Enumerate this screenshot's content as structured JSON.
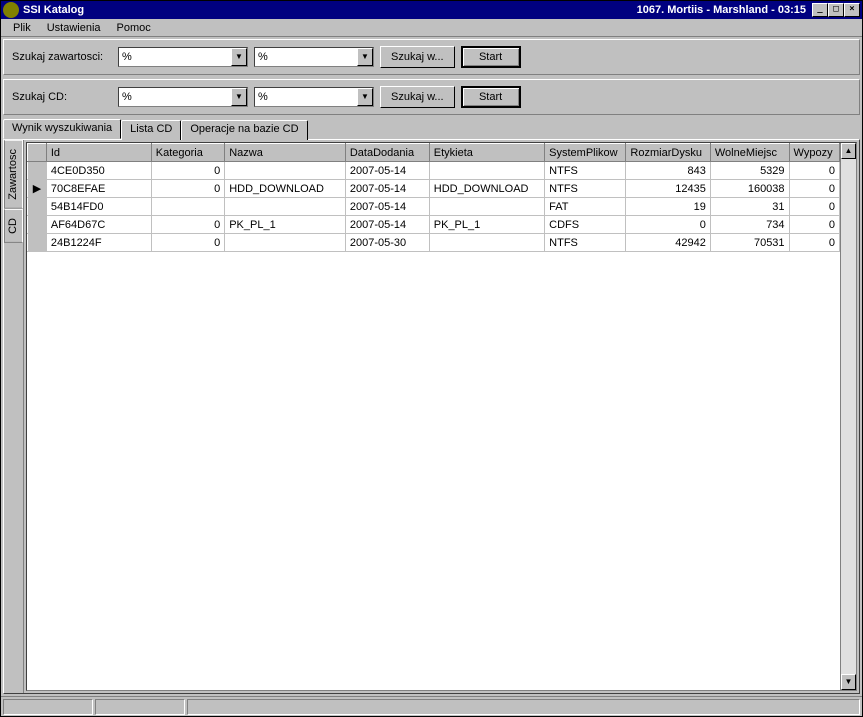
{
  "titlebar": {
    "title": "SSI Katalog",
    "right": "1067. Mortiis - Marshland - 03:15"
  },
  "menu": {
    "file": "Plik",
    "settings": "Ustawienia",
    "help": "Pomoc"
  },
  "search1": {
    "label": "Szukaj zawartosci:",
    "field1": "%",
    "field2": "%",
    "search_btn": "Szukaj w...",
    "start_btn": "Start"
  },
  "search2": {
    "label": "Szukaj CD:",
    "field1": "%",
    "field2": "%",
    "search_btn": "Szukaj w...",
    "start_btn": "Start"
  },
  "tabs": {
    "t0": "Wynik wyszukiwania",
    "t1": "Lista CD",
    "t2": "Operacje na bazie CD"
  },
  "side_tabs": {
    "t0": "Zawartosc",
    "t1": "CD"
  },
  "columns": {
    "c0": "Id",
    "c1": "Kategoria",
    "c2": "Nazwa",
    "c3": "DataDodania",
    "c4": "Etykieta",
    "c5": "SystemPlikow",
    "c6": "RozmiarDysku",
    "c7": "WolneMiejsc",
    "c8": "Wypozy"
  },
  "rows": [
    {
      "id": "4CE0D350",
      "kat": "0",
      "nazwa": "",
      "data": "2007-05-14",
      "ety": "",
      "fs": "NTFS",
      "rozm": "843",
      "wolne": "5329",
      "wyp": "0",
      "sel": ""
    },
    {
      "id": "70C8EFAE",
      "kat": "0",
      "nazwa": "HDD_DOWNLOAD",
      "data": "2007-05-14",
      "ety": "HDD_DOWNLOAD",
      "fs": "NTFS",
      "rozm": "12435",
      "wolne": "160038",
      "wyp": "0",
      "sel": "▶"
    },
    {
      "id": "54B14FD0",
      "kat": "",
      "nazwa": "",
      "data": "2007-05-14",
      "ety": "",
      "fs": "FAT",
      "rozm": "19",
      "wolne": "31",
      "wyp": "0",
      "sel": ""
    },
    {
      "id": "AF64D67C",
      "kat": "0",
      "nazwa": "PK_PL_1",
      "data": "2007-05-14",
      "ety": "PK_PL_1",
      "fs": "CDFS",
      "rozm": "0",
      "wolne": "734",
      "wyp": "0",
      "sel": ""
    },
    {
      "id": "24B1224F",
      "kat": "0",
      "nazwa": "",
      "data": "2007-05-30",
      "ety": "",
      "fs": "NTFS",
      "rozm": "42942",
      "wolne": "70531",
      "wyp": "0",
      "sel": ""
    }
  ]
}
